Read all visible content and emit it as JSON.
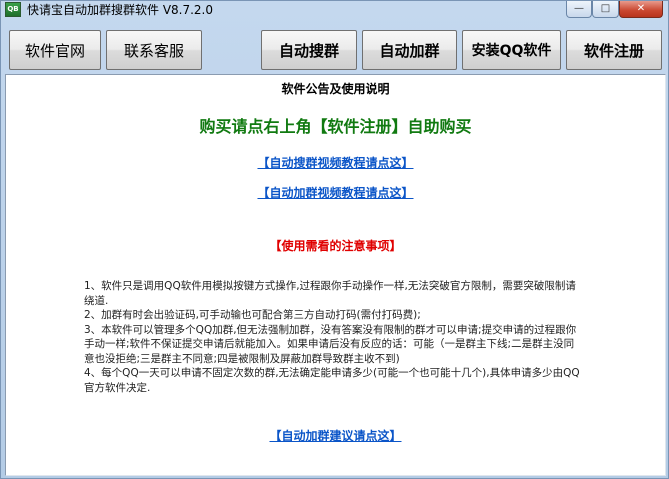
{
  "window": {
    "title": "快请宝自动加群搜群软件 V8.7.2.0",
    "controls": {
      "minimize": "—",
      "maximize": "□",
      "close": "✕"
    }
  },
  "toolbar": {
    "official_site": "软件官网",
    "contact_support": "联系客服",
    "auto_search": "自动搜群",
    "auto_add": "自动加群",
    "install_qq": "安装QQ软件",
    "register": "软件注册"
  },
  "notice": {
    "title": "软件公告及使用说明",
    "buy_line": "购买请点右上角【软件注册】自助购买",
    "link_search_video": "【自动搜群视频教程请点这】",
    "link_add_video": "【自动加群视频教程请点这】",
    "warning_title": "【使用需看的注意事项】",
    "items": [
      "1、软件只是调用QQ软件用模拟按键方式操作,过程跟你手动操作一样,无法突破官方限制，需要突破限制请绕道.",
      "2、加群有时会出验证码,可手动输也可配合第三方自动打码(需付打码费);",
      "3、本软件可以管理多个QQ加群,但无法强制加群，没有答案没有限制的群才可以申请;提交申请的过程跟你手动一样;软件不保证提交申请后就能加入。如果申请后没有反应的话：可能（一是群主下线;二是群主没同意也没拒绝;三是群主不同意;四是被限制及屏蔽加群导致群主收不到)",
      "4、每个QQ一天可以申请不固定次数的群,无法确定能申请多少(可能一个也可能十几个),具体申请多少由QQ官方软件决定."
    ],
    "link_suggest": "【自动加群建议请点这】"
  },
  "colors": {
    "buy_line": "#117a11",
    "link": "#0b55c8",
    "warning": "#e00000"
  }
}
